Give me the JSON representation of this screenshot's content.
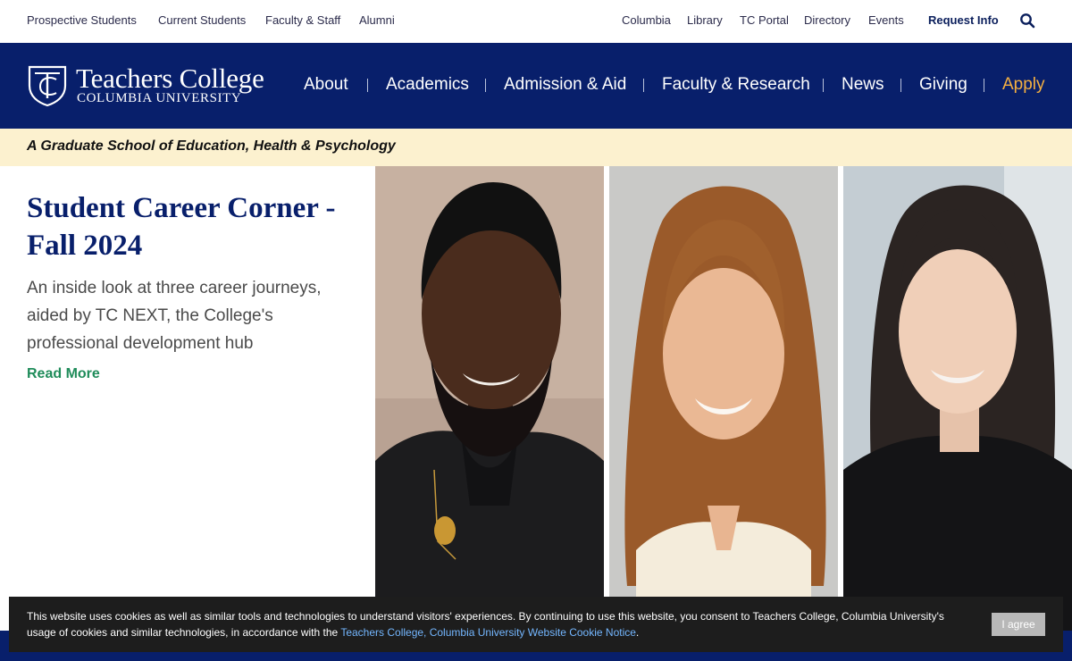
{
  "utility": {
    "links": [
      "Prospective Students",
      "Current Students",
      "Faculty & Staff",
      "Alumni"
    ],
    "right_links": [
      "Columbia",
      "Library",
      "TC Portal",
      "Directory",
      "Events"
    ],
    "request_info": "Request Info",
    "search_icon": "search-icon"
  },
  "logo": {
    "name": "Teachers College",
    "subname": "COLUMBIA UNIVERSITY",
    "monogram": "TC"
  },
  "nav": {
    "items": [
      "About",
      "Academics",
      "Admission & Aid",
      "Faculty & Research",
      "News",
      "Giving"
    ],
    "apply": "Apply",
    "apply_color": "#f5b041"
  },
  "tagline": "A Graduate School of Education, Health & Psychology",
  "hero": {
    "title": "Student Career Corner - Fall 2024",
    "description": "An inside look at three career journeys, aided by TC NEXT, the College's professional development hub",
    "link": "Read More"
  },
  "cookie": {
    "text": "This website uses cookies as well as similar tools and technologies to understand visitors' experiences. By continuing to use this website, you consent to Teachers College, Columbia University's usage of cookies and similar technologies, in accordance with the ",
    "link": "Teachers College, Columbia University Website Cookie Notice",
    "end": ".",
    "button": "I agree"
  },
  "colors": {
    "navy": "#081f6b",
    "cream": "#fcf1cf",
    "green_link": "#1f8c5a"
  }
}
